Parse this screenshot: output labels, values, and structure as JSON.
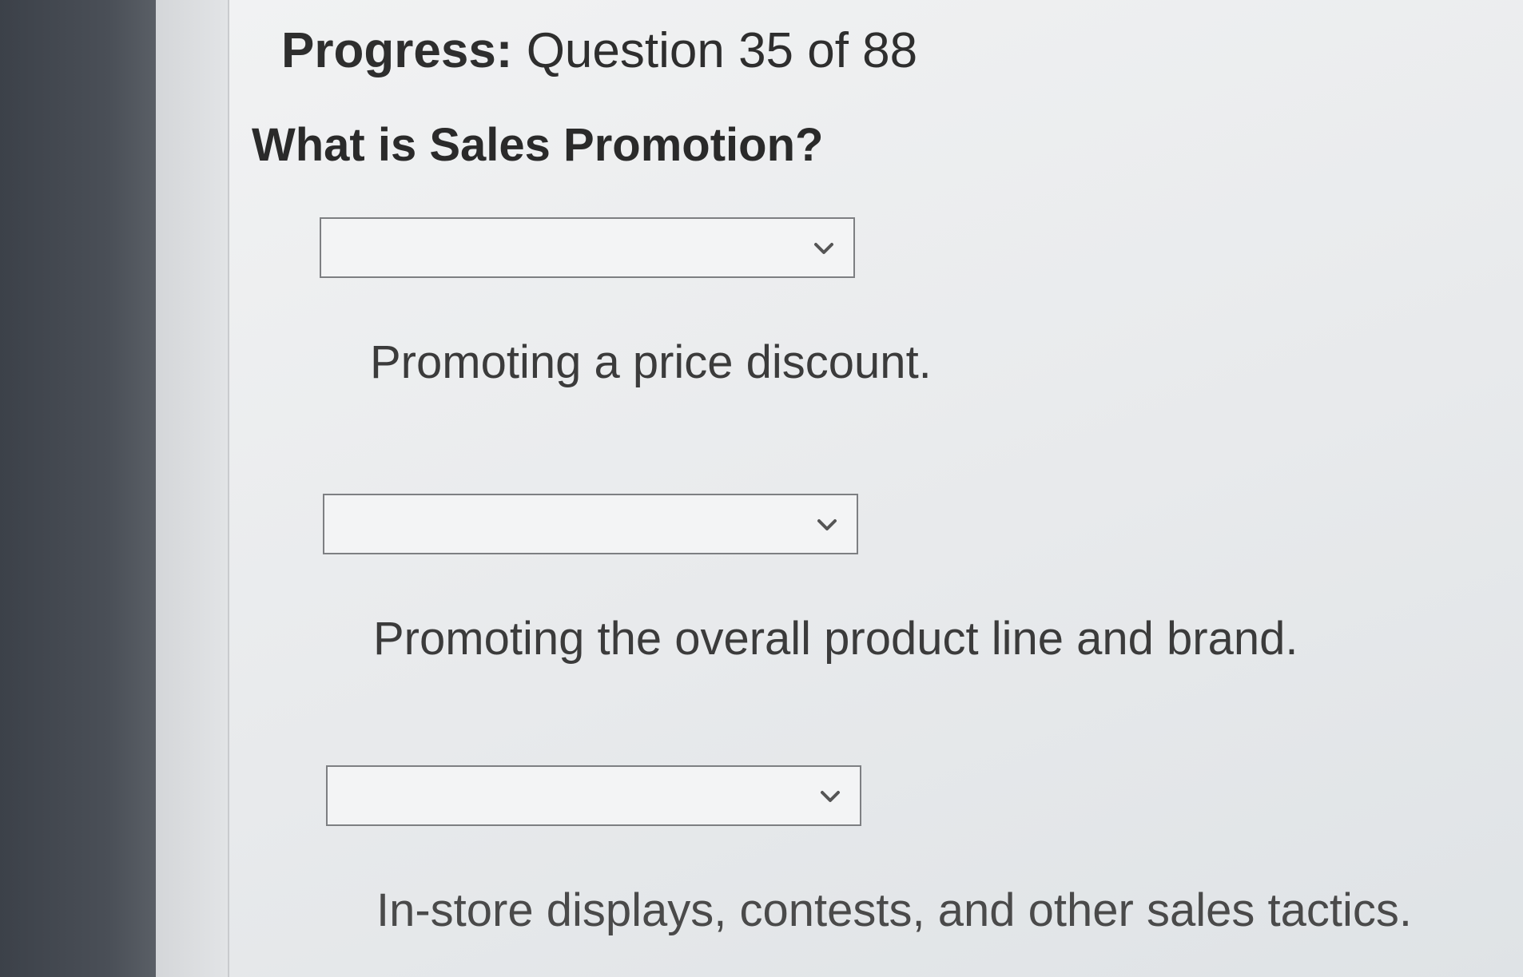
{
  "progress": {
    "label": "Progress:",
    "text": "Question 35 of 88"
  },
  "question": {
    "title": "What is Sales Promotion?"
  },
  "options": [
    {
      "selected_value": "",
      "description": "Promoting a price discount."
    },
    {
      "selected_value": "",
      "description": "Promoting the overall product line and brand."
    },
    {
      "selected_value": "",
      "description": "In-store displays, contests, and other sales tactics."
    }
  ],
  "icons": {
    "dropdown": "chevron-down-icon"
  }
}
